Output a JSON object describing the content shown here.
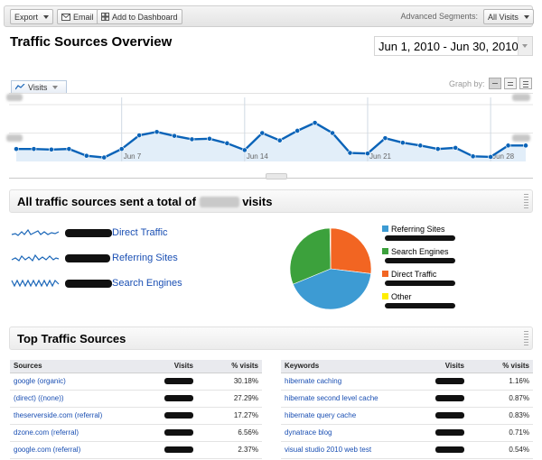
{
  "toolbar": {
    "export_label": "Export",
    "email_label": "Email",
    "add_dashboard_label": "Add to Dashboard",
    "segments_label": "Advanced Segments:",
    "segments_value": "All Visits"
  },
  "header": {
    "title": "Traffic Sources Overview",
    "date_range": "Jun 1, 2010 - Jun 30, 2010"
  },
  "graph": {
    "metric_tab": "Visits",
    "graph_by_label": "Graph by:",
    "fill_color": "#e2eef9",
    "line_color": "#0a63b8"
  },
  "chart_data": {
    "type": "area",
    "x": [
      "Jun 1",
      "Jun 2",
      "Jun 3",
      "Jun 4",
      "Jun 5",
      "Jun 6",
      "Jun 7",
      "Jun 8",
      "Jun 9",
      "Jun 10",
      "Jun 11",
      "Jun 12",
      "Jun 13",
      "Jun 14",
      "Jun 15",
      "Jun 16",
      "Jun 17",
      "Jun 18",
      "Jun 19",
      "Jun 20",
      "Jun 21",
      "Jun 22",
      "Jun 23",
      "Jun 24",
      "Jun 25",
      "Jun 26",
      "Jun 27",
      "Jun 28",
      "Jun 29",
      "Jun 30"
    ],
    "series": [
      {
        "values": [
          0.22,
          0.22,
          0.21,
          0.22,
          0.1,
          0.07,
          0.22,
          0.46,
          0.52,
          0.45,
          0.39,
          0.4,
          0.32,
          0.2,
          0.5,
          0.37,
          0.54,
          0.68,
          0.5,
          0.15,
          0.14,
          0.41,
          0.33,
          0.28,
          0.22,
          0.24,
          0.09,
          0.08,
          0.28,
          0.28
        ]
      }
    ],
    "x_tick_labels": [
      "Jun 7",
      "Jun 14",
      "Jun 21",
      "Jun 28"
    ],
    "ylim": [
      0,
      1
    ],
    "grid": true
  },
  "summary": {
    "text_prefix": "All traffic sources sent a total of",
    "text_suffix": "visits"
  },
  "sources": [
    {
      "label": "Direct Traffic"
    },
    {
      "label": "Referring Sites"
    },
    {
      "label": "Search Engines"
    }
  ],
  "pie": {
    "slices": [
      {
        "name": "Referring Sites",
        "value": 42,
        "color": "#3d9bd3"
      },
      {
        "name": "Search Engines",
        "value": 31,
        "color": "#3ca13c"
      },
      {
        "name": "Direct Traffic",
        "value": 27,
        "color": "#f26522"
      },
      {
        "name": "Other",
        "value": 0.3,
        "color": "#ffee00"
      }
    ]
  },
  "top_section": {
    "title": "Top Traffic Sources"
  },
  "sources_table": {
    "headers": [
      "Sources",
      "Visits",
      "% visits"
    ],
    "rows": [
      {
        "name": "google (organic)",
        "pct": "30.18%"
      },
      {
        "name": "(direct) ((none))",
        "pct": "27.29%"
      },
      {
        "name": "theserverside.com (referral)",
        "pct": "17.27%"
      },
      {
        "name": "dzone.com (referral)",
        "pct": "6.56%"
      },
      {
        "name": "google.com (referral)",
        "pct": "2.37%"
      }
    ]
  },
  "keywords_table": {
    "headers": [
      "Keywords",
      "Visits",
      "% visits"
    ],
    "rows": [
      {
        "name": "hibernate caching",
        "pct": "1.16%"
      },
      {
        "name": "hibernate second level cache",
        "pct": "0.87%"
      },
      {
        "name": "hibernate query cache",
        "pct": "0.83%"
      },
      {
        "name": "dynatrace blog",
        "pct": "0.71%"
      },
      {
        "name": "visual studio 2010 web test",
        "pct": "0.54%"
      }
    ]
  }
}
